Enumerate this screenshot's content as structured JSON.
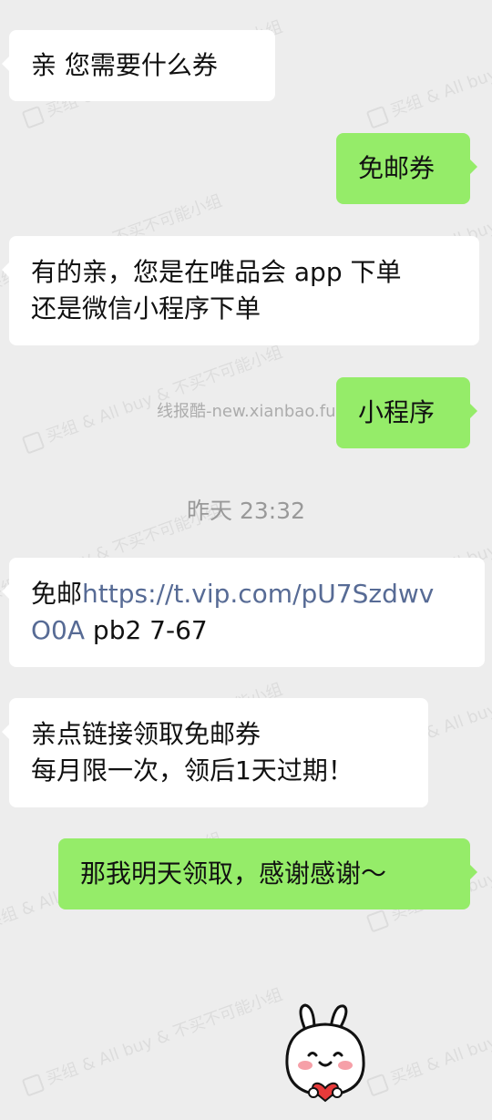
{
  "watermark": {
    "tile_text": "买组 & All buy & 不买不可能小组",
    "center_text": "线报酷-new.xianbao.fun"
  },
  "messages": [
    {
      "side": "left",
      "lines": [
        "亲 您需要什么券"
      ]
    },
    {
      "side": "right",
      "lines": [
        "免邮券"
      ]
    },
    {
      "side": "left",
      "lines": [
        "有的亲，您是在唯品会 app 下单",
        "还是微信小程序下单"
      ]
    },
    {
      "side": "right",
      "lines": [
        "小程序"
      ]
    },
    {
      "side": "left",
      "lines": [
        "免邮",
        "https://t.vip.com/pU7Szdwv",
        "O0A",
        " pb2 7-67"
      ]
    },
    {
      "side": "left",
      "lines": [
        "亲点链接领取免邮券",
        "每月限一次，领后1天过期！"
      ]
    },
    {
      "side": "right",
      "lines": [
        "那我明天领取，感谢感谢～"
      ]
    }
  ],
  "timestamp": "昨天 23:32",
  "sticker": {
    "icon": "bunny-heart-sticker-icon",
    "heart_color": "#e63a3a"
  },
  "colors": {
    "background": "#ededed",
    "incoming_bubble": "#ffffff",
    "outgoing_bubble": "#95ec69",
    "link": "#576b95",
    "timestamp": "#999999"
  }
}
